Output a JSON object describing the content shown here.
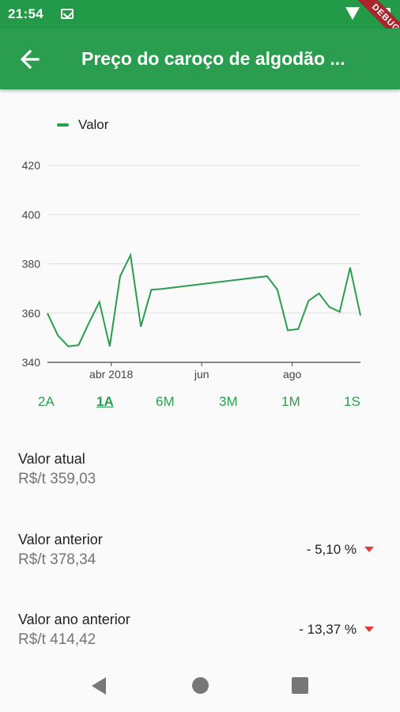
{
  "status_bar": {
    "time": "21:54",
    "debug_label": "DEBUG"
  },
  "app_bar": {
    "title": "Preço do caroço de algodão ..."
  },
  "legend": {
    "label": "Valor",
    "color": "#2a9d4e"
  },
  "chart_data": {
    "type": "line",
    "series": [
      {
        "name": "Valor",
        "x": [
          "2018-02-17",
          "2018-02-24",
          "2018-03-03",
          "2018-03-10",
          "2018-03-17",
          "2018-03-24",
          "2018-03-31",
          "2018-04-07",
          "2018-04-14",
          "2018-04-21",
          "2018-04-28",
          "2018-05-05",
          "2018-07-15",
          "2018-07-22",
          "2018-07-29",
          "2018-08-05",
          "2018-08-12",
          "2018-08-19",
          "2018-08-26",
          "2018-09-02",
          "2018-09-09",
          "2018-09-16"
        ],
        "values": [
          360,
          351,
          346.5,
          347,
          356,
          364.5,
          346.5,
          375,
          383.5,
          354.5,
          369.5,
          369.8,
          375,
          369.5,
          353,
          353.5,
          365,
          368,
          362.5,
          360.5,
          378.5,
          359
        ]
      }
    ],
    "xlim": [
      "2018-02-17",
      "2018-09-16"
    ],
    "ylim": [
      340,
      420
    ],
    "yticks": [
      "340",
      "360",
      "380",
      "400",
      "420"
    ],
    "xticks": [
      {
        "label": "abr 2018",
        "date": "2018-04-01"
      },
      {
        "label": "jun",
        "date": "2018-06-01"
      },
      {
        "label": "ago",
        "date": "2018-08-01"
      }
    ],
    "grid": true,
    "legend_position": "top-left"
  },
  "range_tabs": [
    {
      "label": "2A",
      "active": false
    },
    {
      "label": "1A",
      "active": true
    },
    {
      "label": "6M",
      "active": false
    },
    {
      "label": "3M",
      "active": false
    },
    {
      "label": "1M",
      "active": false
    },
    {
      "label": "1S",
      "active": false
    }
  ],
  "values": {
    "current": {
      "label": "Valor atual",
      "amount": "R$/t  359,03"
    },
    "previous": {
      "label": "Valor anterior",
      "amount": "R$/t  378,34",
      "change": "- 5,10 %"
    },
    "last_year": {
      "label": "Valor ano anterior",
      "amount": "R$/t  414,42",
      "change": "- 13,37 %"
    }
  },
  "colors": {
    "primary": "#2a9d4e",
    "status_bar": "#239a48",
    "negative": "#e53935",
    "debug_banner": "#a8262c"
  }
}
